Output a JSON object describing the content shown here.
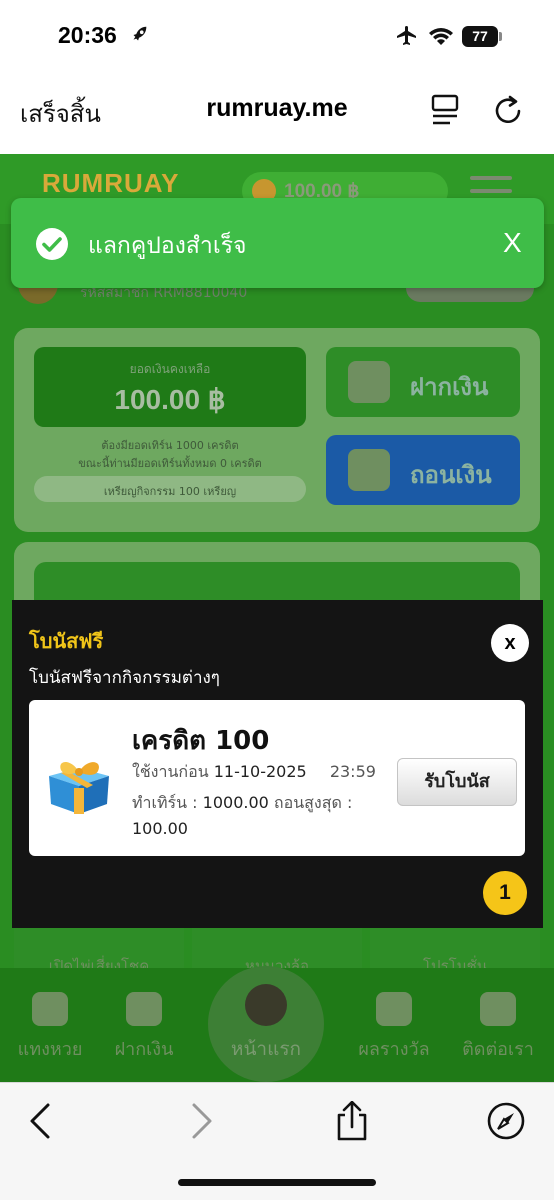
{
  "status_bar": {
    "time": "20:36",
    "battery": "77",
    "icons": [
      "rocket-icon",
      "airplane-icon",
      "wifi-icon",
      "battery-icon"
    ]
  },
  "browser": {
    "done_label": "เสร็จสิ้น",
    "url": "rumruay.me",
    "icons": [
      "reader-icon",
      "reload-icon"
    ]
  },
  "site": {
    "logo": "RUMRUAY",
    "balance": "100.00 ฿",
    "member_id": "รหัสสมาชิก RRM8810040",
    "balance_label": "ยอดเงินคงเหลือ",
    "balance_value": "100.00 ฿",
    "turnover_note": "ต้องมียอดเทิร์น 1000 เครดิต",
    "turnover_current_note": "ขณะนี้ท่านมียอดเทิร์นทั้งหมด 0 เครดิต",
    "coins_note": "เหรียญกิจกรรม 100 เหรียญ",
    "deposit_label": "ฝากเงิน",
    "withdraw_label": "ถอนเงิน",
    "tiles": [
      "เปิดไพ่เสี่ยงโชค",
      "หมุนวงล้อ",
      "โปรโมชั่น"
    ],
    "nav": {
      "lottery": "แทงหวย",
      "deposit": "ฝากเงิน",
      "home": "หน้าแรก",
      "rewards": "ผลรางวัล",
      "contact": "ติดต่อเรา"
    }
  },
  "toast": {
    "message": "แลกคูปองสำเร็จ",
    "close": "X",
    "color": "#3fbd48"
  },
  "modal": {
    "title": "โบนัสฟรี",
    "subtitle": "โบนัสฟรีจากกิจกรรมต่างๆ",
    "close": "x",
    "bonus": {
      "title": "เครดิต 100",
      "expiry_prefix": "ใช้งานก่อน",
      "expiry_date": "11-10-2025",
      "expiry_time": "23:59",
      "turnover_label": "ทำเทิร์น",
      "turnover_value": "1000.00",
      "max_withdraw_label": "ถอนสูงสุด",
      "max_withdraw_value": "100.00",
      "claim_button": "รับโบนัส"
    },
    "page_badge": "1",
    "accent_color": "#f0c419"
  },
  "safari": {
    "icons": [
      "back-icon",
      "forward-icon",
      "share-icon",
      "compass-icon"
    ]
  }
}
